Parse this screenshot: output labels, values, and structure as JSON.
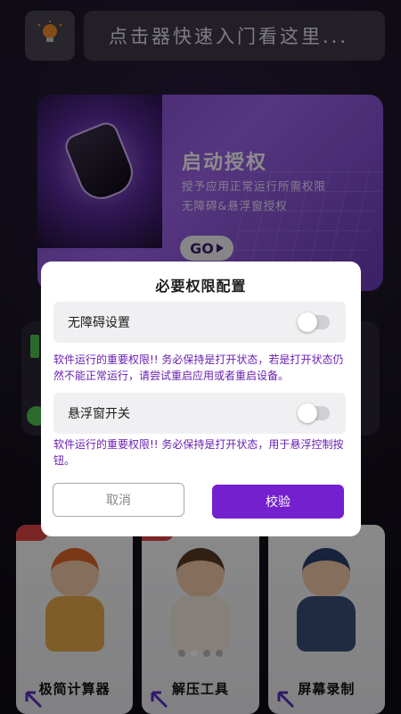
{
  "header": {
    "search_text": "点击器快速入门看这里..."
  },
  "auth_card": {
    "title": "启动授权",
    "subtitle1": "授予应用正常运行所需权限",
    "subtitle2": "无障碍&悬浮窗授权",
    "go_label": "GO"
  },
  "tools": [
    {
      "label": "极简计算器"
    },
    {
      "label": "解压工具"
    },
    {
      "label": "屏幕录制"
    }
  ],
  "carousel": {
    "page_count": 4,
    "active_index": 1
  },
  "dialog": {
    "title": "必要权限配置",
    "permissions": [
      {
        "label": "无障碍设置",
        "enabled": false,
        "note": "软件运行的重要权限!! 务必保持是打开状态，若是打开状态仍然不能正常运行，请尝试重启应用或者重启设备。"
      },
      {
        "label": "悬浮窗开关",
        "enabled": false,
        "note": "软件运行的重要权限!! 务必保持是打开状态，用于悬浮控制按钮。"
      }
    ],
    "cancel_label": "取消",
    "verify_label": "校验"
  },
  "colors": {
    "accent": "#7420cf",
    "note_text": "#6a1fb3",
    "auth_card": "#8b55d8"
  }
}
